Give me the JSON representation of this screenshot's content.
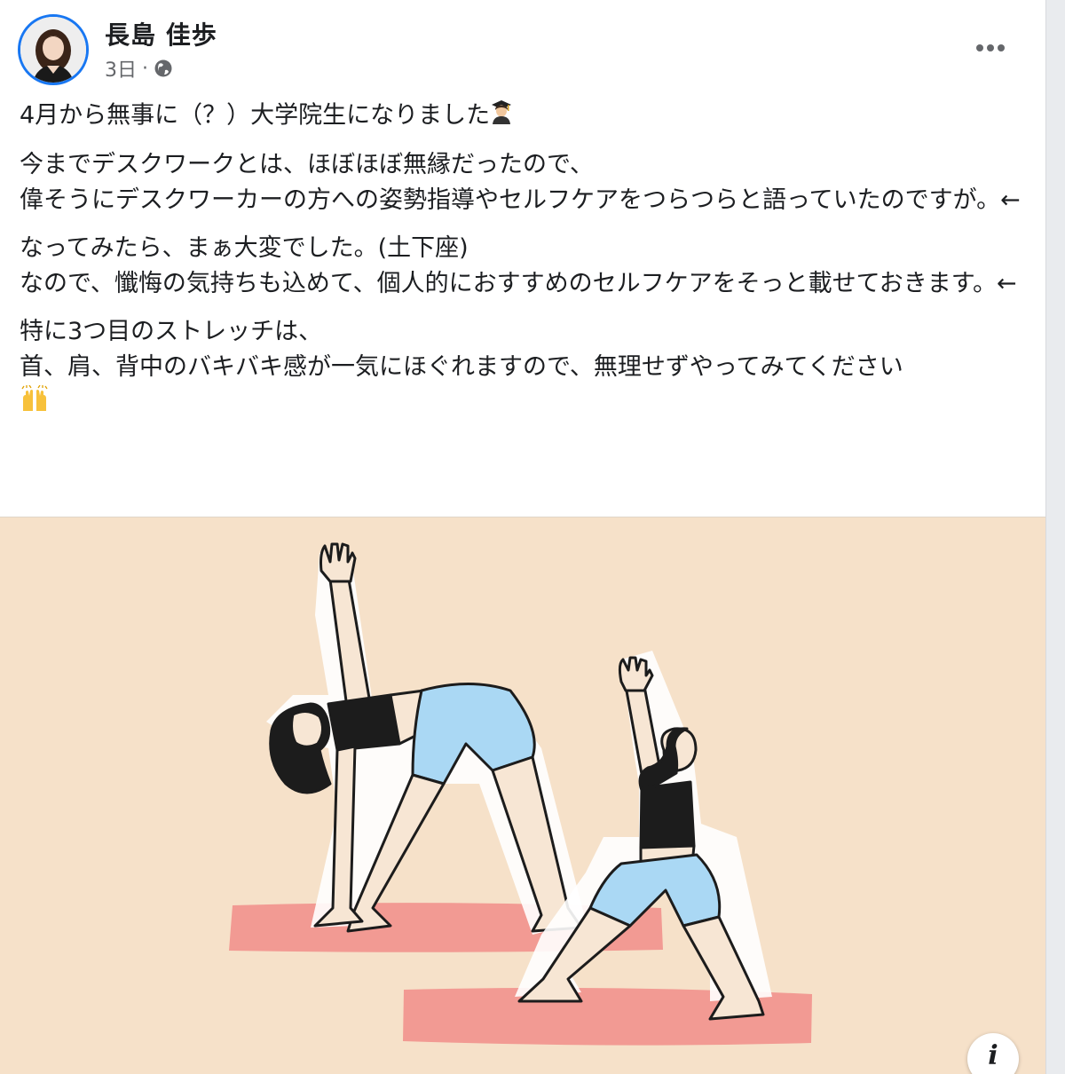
{
  "post": {
    "author_name": "長島 佳歩",
    "timestamp": "3日",
    "separator": "·",
    "privacy_icon": "globe-icon",
    "more_icon": "more-horizontal-icon",
    "paragraphs": [
      "4月から無事に（？）大学院生になりました",
      "今までデスクワークとは、ほぼほぼ無縁だったので、\n偉そうにデスクワーカーの方への姿勢指導やセルフケアをつらつらと語っていたのですが。←",
      "なってみたら、まぁ大変でした。(土下座)\nなので、懺悔の気持ちも込めて、個人的におすすめのセルフケアをそっと載せておきます。←",
      "特に3つ目のストレッチは、\n首、肩、背中のバキバキ感が一気にほぐれますので、無理せずやってみてください"
    ],
    "emojis": [
      "graduate-emoji",
      "raising-hands-emoji"
    ]
  },
  "image": {
    "description_icon": "info-icon",
    "info_label": "i",
    "colors": {
      "background": "#f6e1c9",
      "mat": "#f29a93",
      "shorts": "#aad8f4",
      "skin": "#f7e6d4",
      "outline": "#1c1c1c"
    }
  }
}
